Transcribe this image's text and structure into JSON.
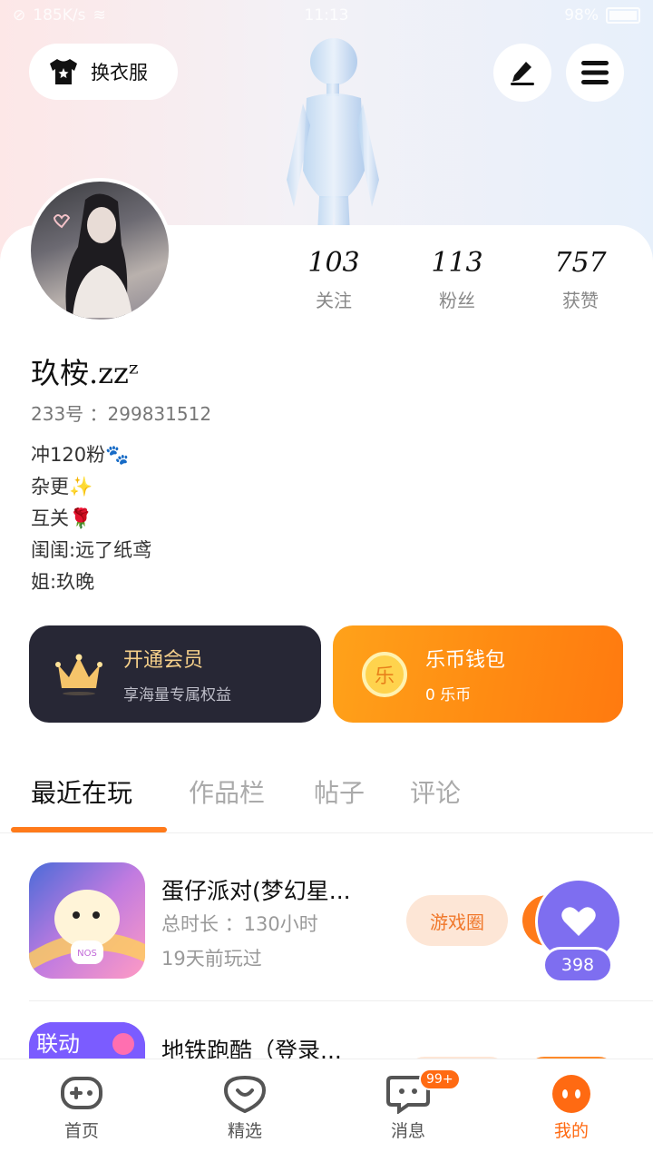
{
  "status_bar": {
    "net_speed": "185K/s",
    "time": "11:13",
    "battery": "98%"
  },
  "header": {
    "outfit_label": "换衣服"
  },
  "profile": {
    "name": "玖桉.zzᶻ",
    "uid": "233号 ：299831512",
    "stats": [
      {
        "num": "103",
        "label": "关注"
      },
      {
        "num": "113",
        "label": "粉丝"
      },
      {
        "num": "757",
        "label": "获赞"
      }
    ],
    "bio": [
      "冲120粉🐾",
      "杂更✨",
      "互关🌹",
      "闺闺:远了纸鸢",
      "姐:玖晚"
    ]
  },
  "vip": {
    "title": "开通会员",
    "subtitle": "享海量专属权益"
  },
  "wallet": {
    "title": "乐币钱包",
    "subtitle": "0 乐币",
    "coin_char": "乐"
  },
  "tabs": [
    "最近在玩",
    "作品栏",
    "帖子",
    "评论"
  ],
  "games": [
    {
      "title": "蛋仔派对(梦幻星...",
      "duration": "总时长 ：130小时",
      "last": "19天前玩过",
      "circle_label": "游戏圈"
    },
    {
      "title": "地铁跑酷（登录...",
      "banner": "联动"
    }
  ],
  "float_like": {
    "count": "398"
  },
  "bottom_nav": [
    {
      "label": "首页",
      "icon": "gamepad-icon"
    },
    {
      "label": "精选",
      "icon": "heart-chat-icon"
    },
    {
      "label": "消息",
      "icon": "message-icon",
      "badge": "99+"
    },
    {
      "label": "我的",
      "icon": "me-face-icon"
    }
  ],
  "colors": {
    "accent": "#ff7a1a",
    "vip_bg": "#272735",
    "like_purple": "#7e6ef0"
  }
}
